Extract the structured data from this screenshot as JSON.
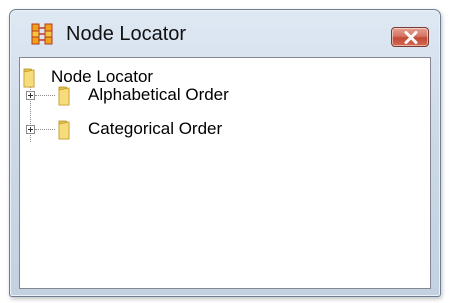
{
  "window": {
    "title": "Node Locator",
    "icon": "node-locator-app-icon",
    "close_icon": "close-icon"
  },
  "tree": {
    "root": {
      "label": "Node Locator",
      "icon": "folder-icon"
    },
    "children": [
      {
        "label": "Alphabetical Order",
        "icon": "folder-icon",
        "expanded": false
      },
      {
        "label": "Categorical Order",
        "icon": "folder-icon",
        "expanded": false
      }
    ]
  },
  "colors": {
    "close_button": "#c24a36",
    "folder": "#e8c24a",
    "app_icon": "#f2a11c"
  }
}
